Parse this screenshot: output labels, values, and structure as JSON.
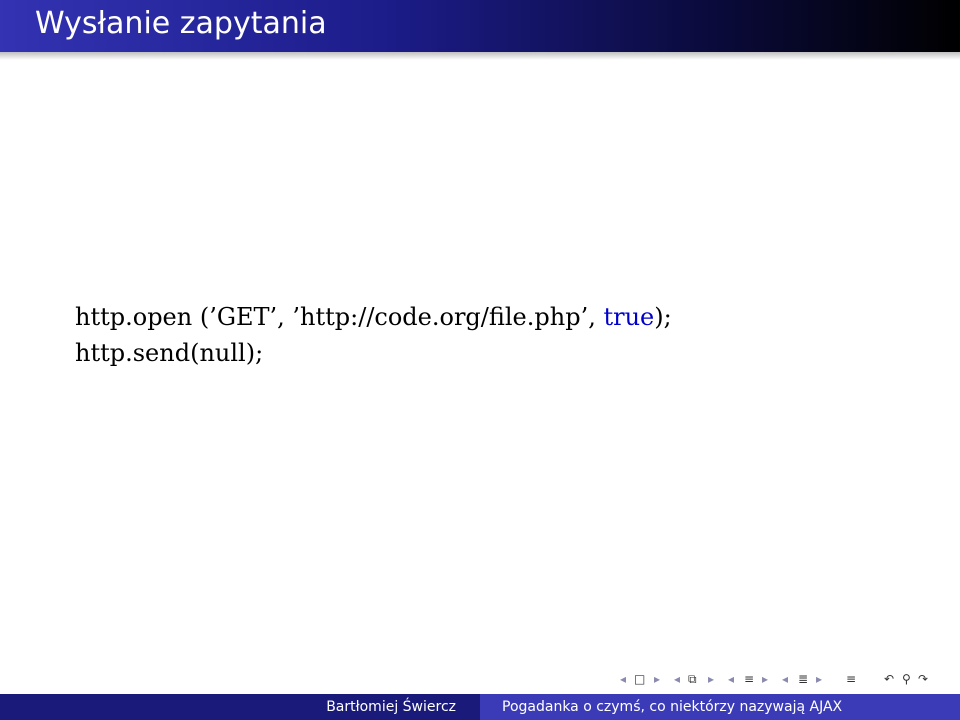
{
  "slide": {
    "title": "Wysłanie zapytania",
    "code": {
      "line1_start": "http.open (’GET’, ’http://code.org/file.php’, ",
      "line1_keyword": "true",
      "line1_end": ");",
      "line2": "http.send(null);"
    }
  },
  "navigation": {
    "icons": [
      "arrow-left-icon",
      "frame-icon",
      "arrow-right-icon",
      "arrow-left-icon",
      "subsection-icon",
      "arrow-right-icon",
      "arrow-left-icon",
      "section-icon",
      "arrow-right-icon",
      "arrow-left-icon",
      "presentation-icon",
      "arrow-right-icon",
      "align-icon",
      "undo-icon",
      "search-icon",
      "redo-icon"
    ]
  },
  "footer": {
    "author": "Bartłomiej Świercz",
    "title": "Pogadanka o czymś, co niektórzy nazywają AJAX"
  },
  "colors": {
    "title_bar_start": "#3333b3",
    "title_bar_end": "#000000",
    "footer_left": "#1a1a7a",
    "footer_right": "#3b3bb8",
    "keyword": "#0000cc"
  }
}
